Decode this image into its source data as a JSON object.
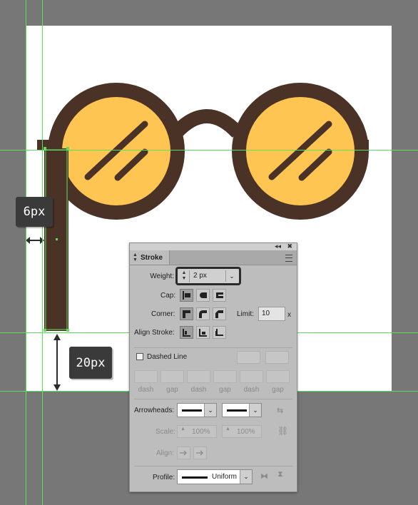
{
  "measurements": {
    "width_callout": "6px",
    "height_callout": "20px"
  },
  "colors": {
    "lens": "#ffc552",
    "frame": "#4a3326",
    "guide": "#5be05b",
    "canvas": "#ffffff",
    "workspace": "#777777"
  },
  "stroke_panel": {
    "tab_label": "Stroke",
    "weight": {
      "label": "Weight:",
      "value": "2 px"
    },
    "cap_label": "Cap:",
    "corner_label": "Corner:",
    "limit": {
      "label": "Limit:",
      "value": "10",
      "unit": "x"
    },
    "align_stroke_label": "Align Stroke:",
    "dashed_line_label": "Dashed Line",
    "dash_gap_labels": [
      "dash",
      "gap",
      "dash",
      "gap",
      "dash",
      "gap"
    ],
    "arrowheads_label": "Arrowheads:",
    "scale": {
      "label": "Scale:",
      "start": "100%",
      "end": "100%"
    },
    "align_label": "Align:",
    "profile": {
      "label": "Profile:",
      "value": "Uniform"
    }
  }
}
